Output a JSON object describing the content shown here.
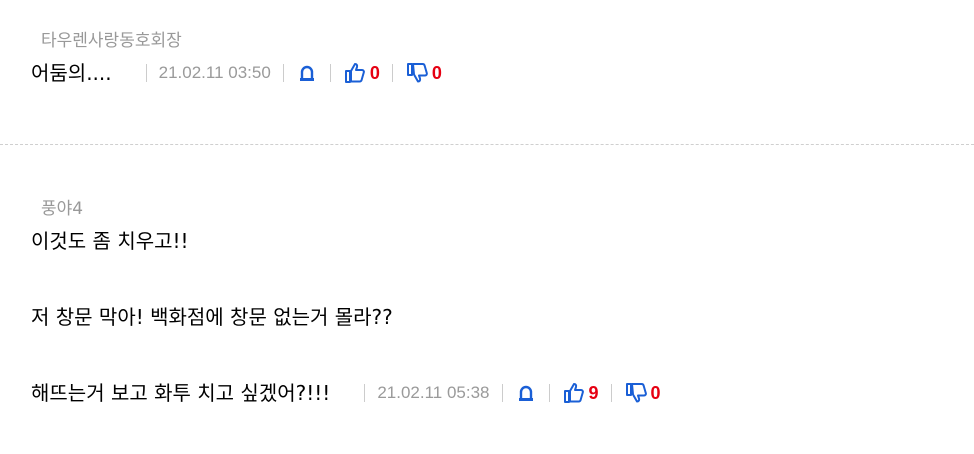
{
  "comments": [
    {
      "author": "타우렌사랑동호회장",
      "lines": [
        "어둠의...."
      ],
      "date": "21.02.11 03:50",
      "likes": "0",
      "dislikes": "0"
    },
    {
      "author": "풍야4",
      "lines": [
        "이것도 좀 치우고!!",
        "저 창문 막아! 백화점에 창문 없는거 몰라??",
        "해뜨는거 보고 화투 치고 싶겠어?!!!"
      ],
      "date": "21.02.11 05:38",
      "likes": "9",
      "dislikes": "0"
    }
  ],
  "icons": {
    "report": "siren-icon",
    "like": "thumbs-up-icon",
    "dislike": "thumbs-down-icon"
  },
  "colors": {
    "icon_blue": "#1a5fd6",
    "count_red": "#e60012"
  }
}
